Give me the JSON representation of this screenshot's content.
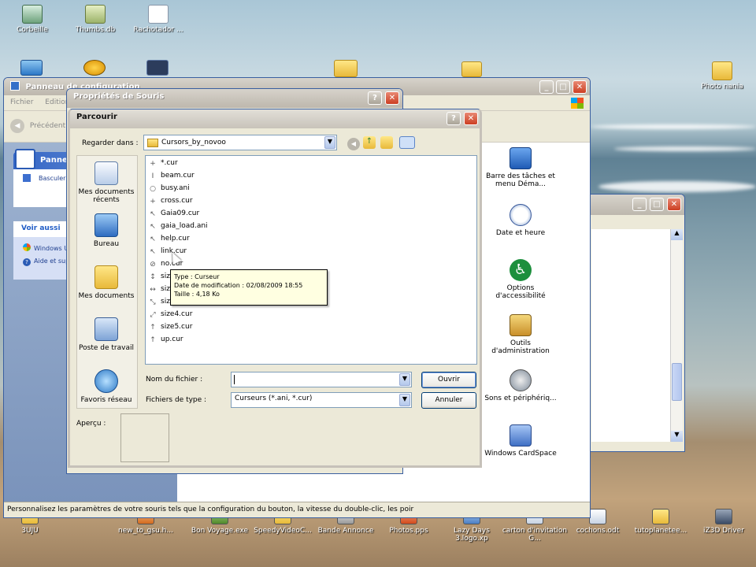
{
  "desktop": {
    "top_icons": [
      {
        "label": "Corbeille",
        "icon": "recycle-bin-icon"
      },
      {
        "label": "Thumbs.db",
        "icon": "db-file-icon"
      },
      {
        "label": "Rachotador ...",
        "icon": "audio-file-icon"
      }
    ],
    "right_icon": {
      "label": "Photo nania",
      "icon": "folder-icon"
    },
    "bottom_icons": [
      {
        "label": "3UJU",
        "icon": "folder-icon"
      },
      {
        "label": "new_to_gsu.h...",
        "icon": "web-file-icon"
      },
      {
        "label": "Bon Voyage.exe",
        "icon": "exe-icon"
      },
      {
        "label": "SpeedyVideoC...",
        "icon": "folder-icon"
      },
      {
        "label": "Bande Annonce",
        "icon": "video-icon"
      },
      {
        "label": "Photos.pps",
        "icon": "pps-icon"
      },
      {
        "label": "Lazy Days 3.logo.xp",
        "icon": "image-icon"
      },
      {
        "label": "carton d'invitation G...",
        "icon": "document-icon"
      },
      {
        "label": "cochons.odt",
        "icon": "document-icon"
      },
      {
        "label": "tutoplanetee...",
        "icon": "folder-icon"
      },
      {
        "label": "iZ3D Driver",
        "icon": "driver-icon"
      }
    ]
  },
  "control_panel": {
    "title": "Panneau de configuration",
    "menu": [
      "Fichier",
      "Edition"
    ],
    "back_label": "Précédent",
    "panel_title": "Panneau",
    "switch_link": "Basculer vers l'affichage des catégories",
    "see_also_title": "Voir aussi",
    "see_also_items": [
      "Windows Update",
      "Aide et support"
    ],
    "icons": [
      {
        "label": "Barre des tâches et menu Déma...",
        "icon": "taskbar-icon"
      },
      {
        "label": "Date et heure",
        "icon": "clock-icon"
      },
      {
        "label": "Options d'accessibilité",
        "icon": "accessibility-icon"
      },
      {
        "label": "Outils d'administration",
        "icon": "admin-tools-icon"
      },
      {
        "label": "Sons et périphériq...",
        "icon": "speaker-icon"
      },
      {
        "label": "Windows CardSpace",
        "icon": "cardspace-icon"
      }
    ],
    "status_text": "Personnalisez les paramètres de votre souris tels que la configuration du bouton, la vitesse du double-clic, les poir"
  },
  "mouse_props": {
    "title": "Propriétés de Souris"
  },
  "browse_dialog": {
    "title": "Parcourir",
    "look_in_label": "Regarder dans :",
    "look_in_value": "Cursors_by_novoo",
    "places": [
      "Mes documents récents",
      "Bureau",
      "Mes documents",
      "Poste de travail",
      "Favoris réseau"
    ],
    "files": [
      "*.cur",
      "beam.cur",
      "busy.ani",
      "cross.cur",
      "Gaia09.cur",
      "gaia_load.ani",
      "help.cur",
      "link.cur",
      "no.cur",
      "size1.cur",
      "size2.cur",
      "size3.cur",
      "size4.cur",
      "size5.cur",
      "up.cur"
    ],
    "tooltip": {
      "type_line": "Type : Curseur",
      "date_line": "Date de modification : 02/08/2009 18:55",
      "size_line": "Taille : 4,18 Ko"
    },
    "filename_label": "Nom du fichier :",
    "filename_value": "",
    "filetype_label": "Fichiers de type :",
    "filetype_value": "Curseurs (*.ani, *.cur)",
    "open_button": "Ouvrir",
    "cancel_button": "Annuler",
    "preview_label": "Aperçu :"
  },
  "colors": {
    "dialog_bg": "#ece9d8",
    "dialog_frame": "#c6c1b9",
    "tooltip_bg": "#ffffe1",
    "titlebar_blue": "#0a246a"
  }
}
